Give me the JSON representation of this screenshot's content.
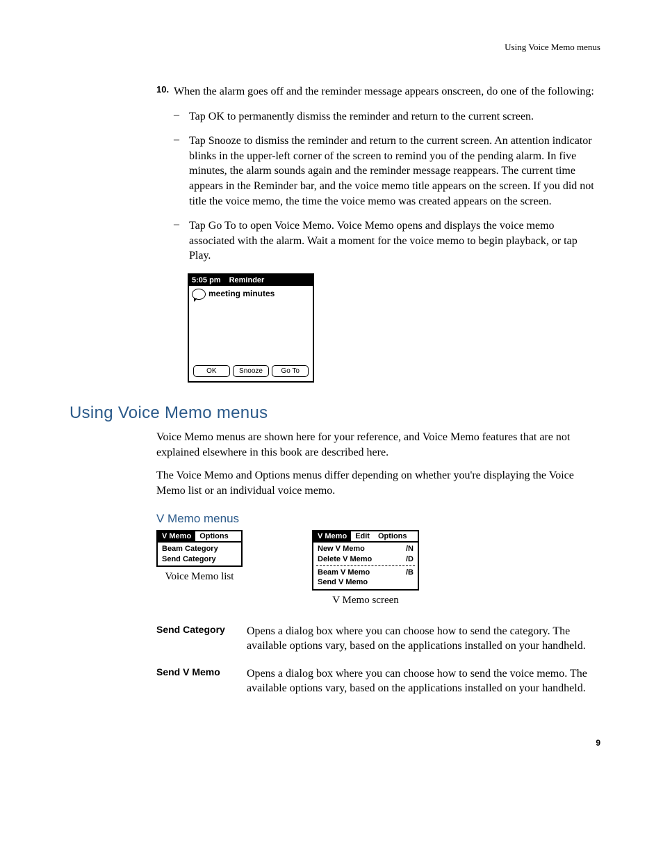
{
  "running_head": "Using Voice Memo menus",
  "step": {
    "number": "10.",
    "text": "When the alarm goes off and the reminder message appears onscreen, do one of the following:",
    "bullets": [
      "Tap OK to permanently dismiss the reminder and return to the current screen.",
      "Tap Snooze to dismiss the reminder and return to the current screen. An attention indicator blinks in the upper-left corner of the screen to remind you of the pending alarm. In five minutes, the alarm sounds again and the reminder message reappears. The current time appears in the Reminder bar, and the voice memo title appears on the screen. If you did not title the voice memo, the time the voice memo was created appears on the screen.",
      "Tap Go To to open Voice Memo. Voice Memo opens and displays the voice memo associated with the alarm. Wait a moment for the voice memo to begin playback, or tap Play."
    ]
  },
  "reminder": {
    "time": "5:05 pm",
    "title": "Reminder",
    "content": "meeting minutes",
    "buttons": {
      "ok": "OK",
      "snooze": "Snooze",
      "goto": "Go To"
    }
  },
  "section_heading": "Using Voice Memo menus",
  "section_p1": "Voice Memo menus are shown here for your reference, and Voice Memo features that are not explained elsewhere in this book are described here.",
  "section_p2": "The Voice Memo and Options menus differ depending on whether you're displaying the Voice Memo list or an individual voice memo.",
  "sub_heading": "V Memo menus",
  "menus": {
    "list": {
      "tabs": [
        "V Memo",
        "Options"
      ],
      "items": [
        "Beam Category",
        "Send Category"
      ],
      "caption": "Voice Memo list"
    },
    "screen": {
      "tabs": [
        "V Memo",
        "Edit",
        "Options"
      ],
      "items": [
        {
          "label": "New V Memo",
          "sc": "/N"
        },
        {
          "label": "Delete V Memo",
          "sc": "/D"
        },
        {
          "label": "Beam V Memo",
          "sc": "/B"
        },
        {
          "label": "Send V Memo",
          "sc": ""
        }
      ],
      "caption": "V Memo screen"
    }
  },
  "defs": [
    {
      "term": "Send Category",
      "desc": "Opens a dialog box where you can choose how to send the category. The available options vary, based on the applications installed on your handheld."
    },
    {
      "term": "Send V Memo",
      "desc": "Opens a dialog box where you can choose how to send the voice memo. The available options vary, based on the applications installed on your handheld."
    }
  ],
  "page_number": "9"
}
